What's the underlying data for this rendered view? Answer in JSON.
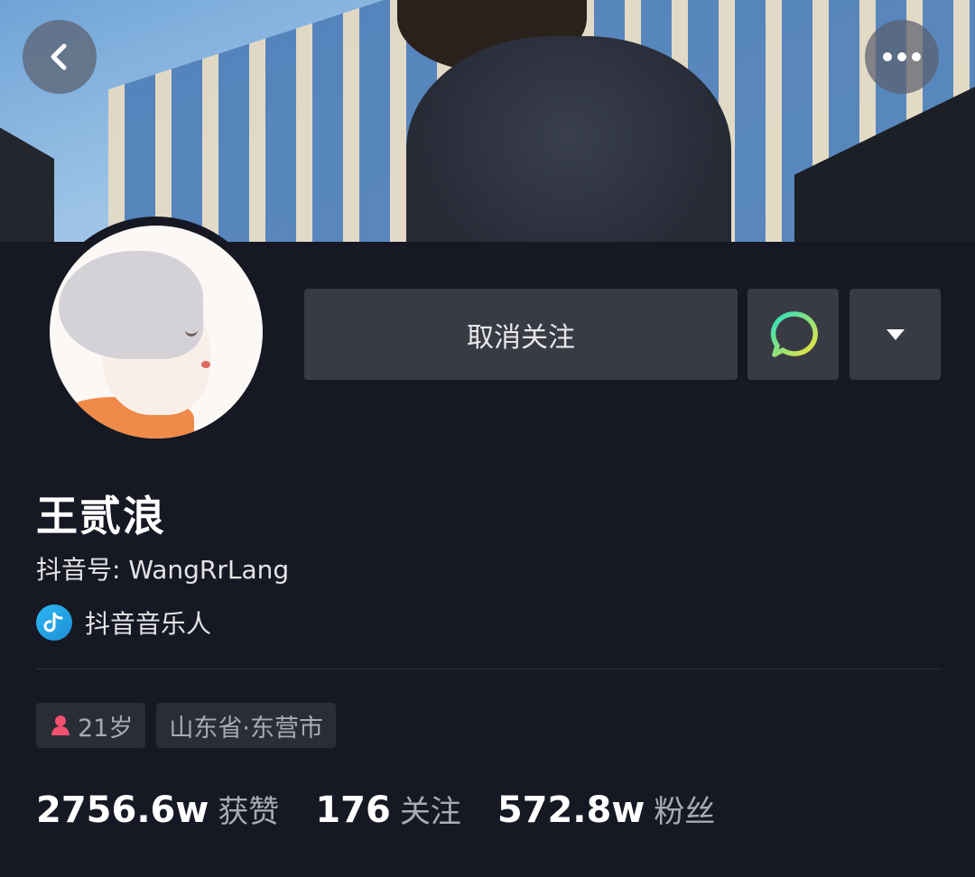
{
  "header": {
    "back_icon": "chevron-left-icon",
    "more_icon": "more-horizontal-icon"
  },
  "actions": {
    "unfollow_label": "取消关注",
    "message_icon": "chat-bubble-icon",
    "dropdown_icon": "caret-down-icon"
  },
  "profile": {
    "name": "王贰浪",
    "douyin_id": "抖音号: WangRrLang",
    "badge_icon": "douyin-music-icon",
    "badge_label": "抖音音乐人"
  },
  "tags": [
    {
      "icon": "female-person-icon",
      "label": "21岁"
    },
    {
      "label": "山东省·东营市"
    }
  ],
  "stats": [
    {
      "value": "2756.6w",
      "label": "获赞"
    },
    {
      "value": "176",
      "label": "关注"
    },
    {
      "value": "572.8w",
      "label": "粉丝"
    }
  ],
  "colors": {
    "background": "#161823",
    "button_bg": "#393b44",
    "tag_bg": "#2a2c36",
    "muted_text": "#a9abb3",
    "gender_pink": "#f2516f",
    "chat_gradient_start": "#27e0c0",
    "chat_gradient_end": "#f4e43a"
  }
}
